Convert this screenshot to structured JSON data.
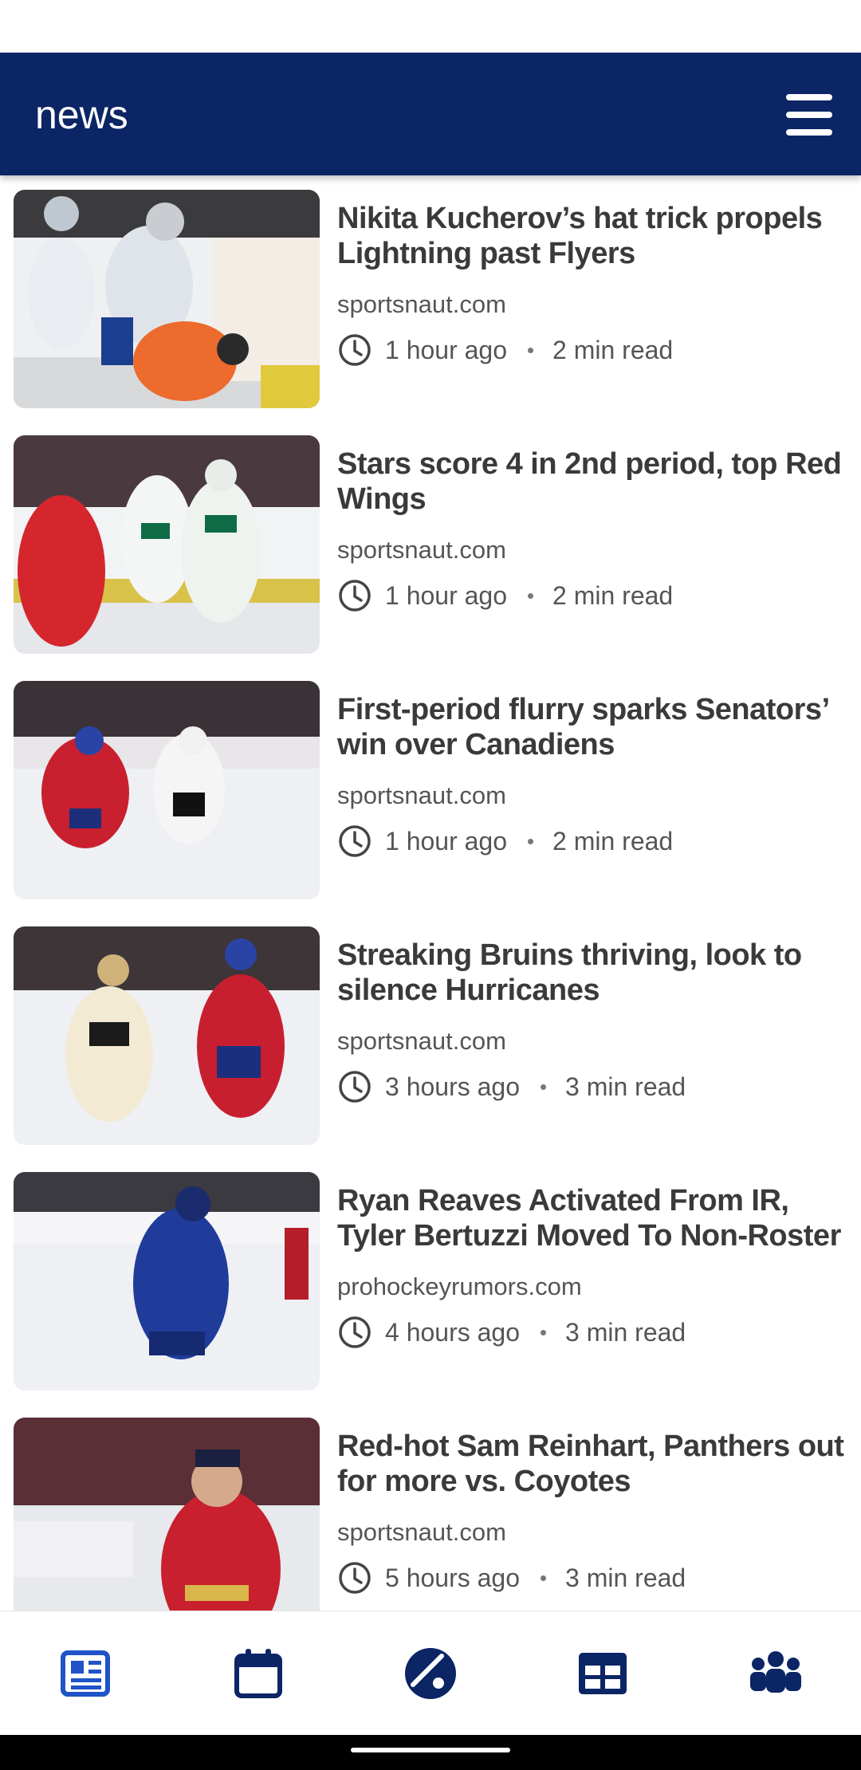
{
  "app_bar": {
    "title": "news",
    "menu_icon": "hamburger-menu-icon"
  },
  "articles": [
    {
      "headline": "Nikita Kucherov’s hat trick propels Lightning past Flyers",
      "source": "sportsnaut.com",
      "time": "1 hour ago",
      "read_time": "2 min read"
    },
    {
      "headline": "Stars score 4 in 2nd period, top Red Wings",
      "source": "sportsnaut.com",
      "time": "1 hour ago",
      "read_time": "2 min read"
    },
    {
      "headline": "First-period flurry sparks Senators’ win over Canadiens",
      "source": "sportsnaut.com",
      "time": "1 hour ago",
      "read_time": "2 min read"
    },
    {
      "headline": "Streaking Bruins thriving, look to silence Hurricanes",
      "source": "sportsnaut.com",
      "time": "3 hours ago",
      "read_time": "3 min read"
    },
    {
      "headline": "Ryan Reaves Activated From IR, Tyler Bertuzzi Moved To Non-Roster",
      "source": "prohockeyrumors.com",
      "time": "4 hours ago",
      "read_time": "3 min read"
    },
    {
      "headline": "Red-hot Sam Reinhart, Panthers out for more vs. Coyotes",
      "source": "sportsnaut.com",
      "time": "5 hours ago",
      "read_time": "3 min read"
    }
  ],
  "bottom_nav": [
    {
      "icon": "news-icon",
      "active": true
    },
    {
      "icon": "calendar-icon",
      "active": false
    },
    {
      "icon": "puck-stick-icon",
      "active": false
    },
    {
      "icon": "standings-table-icon",
      "active": false
    },
    {
      "icon": "teams-group-icon",
      "active": false
    }
  ],
  "colors": {
    "primary": "#0b2565",
    "active_nav": "#1f53c7",
    "text": "#3a3a3a",
    "muted": "#555555"
  }
}
